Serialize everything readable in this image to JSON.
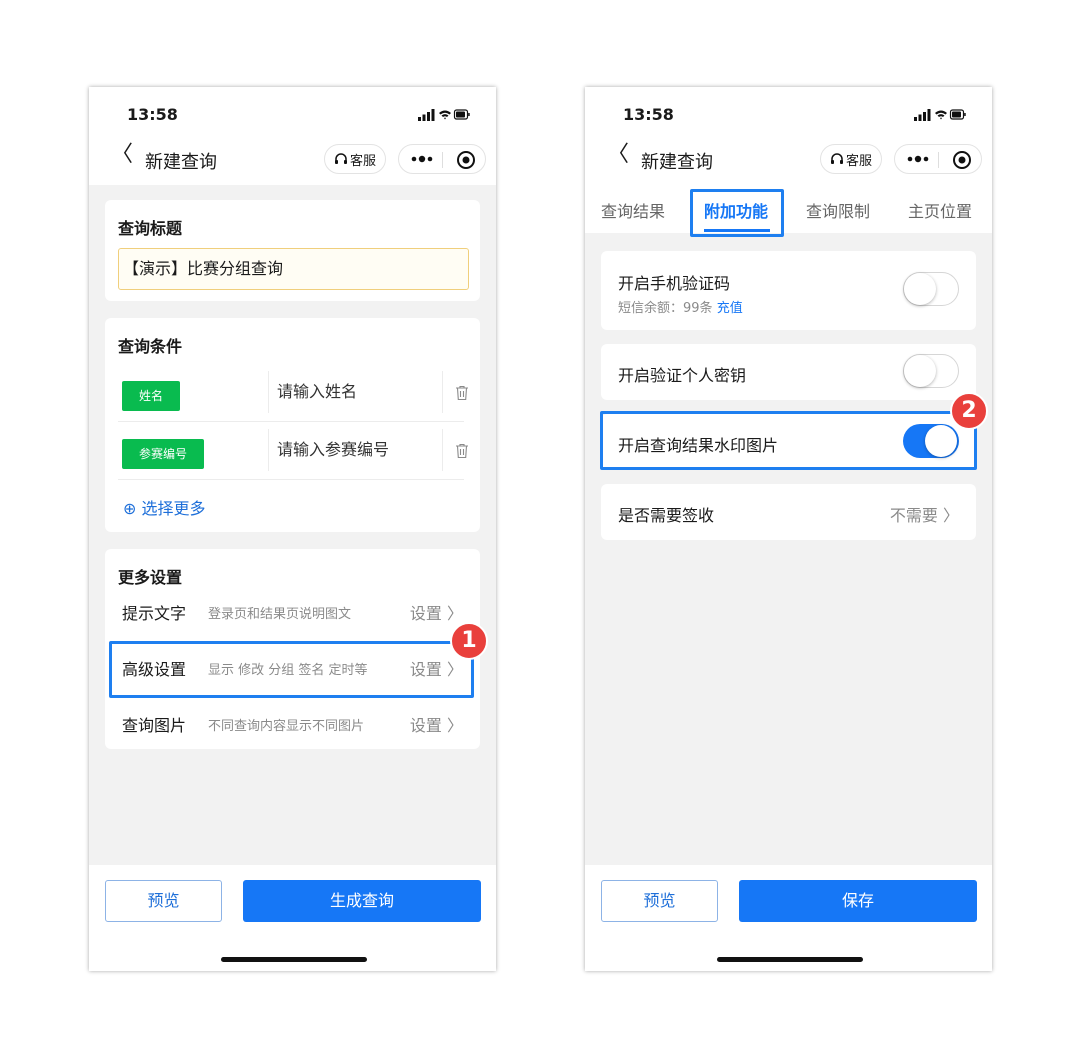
{
  "left_phone": {
    "status": {
      "time": "13:58"
    },
    "nav": {
      "title": "新建查询",
      "service_label": "客服"
    },
    "query_title": {
      "heading": "查询标题",
      "value": "【演示】比赛分组查询"
    },
    "query_conditions": {
      "heading": "查询条件",
      "rows": [
        {
          "tag": "姓名",
          "placeholder": "请输入姓名"
        },
        {
          "tag": "参赛编号",
          "placeholder": "请输入参赛编号"
        }
      ],
      "select_more": "⊕ 选择更多"
    },
    "more_settings": {
      "heading": "更多设置",
      "rows": [
        {
          "label": "提示文字",
          "desc": "登录页和结果页说明图文",
          "action": "设置 〉"
        },
        {
          "label": "高级设置",
          "desc": "显示 修改 分组 签名 定时等",
          "action": "设置 〉"
        },
        {
          "label": "查询图片",
          "desc": "不同查询内容显示不同图片",
          "action": "设置 〉"
        }
      ]
    },
    "bottom": {
      "preview": "预览",
      "primary": "生成查询"
    },
    "badge": "1"
  },
  "right_phone": {
    "status": {
      "time": "13:58"
    },
    "nav": {
      "title": "新建查询",
      "service_label": "客服"
    },
    "tabs": [
      "查询结果",
      "附加功能",
      "查询限制",
      "主页位置"
    ],
    "active_tab": "附加功能",
    "sms": {
      "label": "开启手机验证码",
      "balance": "短信余额：99条",
      "recharge": "充值",
      "enabled": false
    },
    "secret_key": {
      "label": "开启验证个人密钥",
      "enabled": false
    },
    "watermark": {
      "label": "开启查询结果水印图片",
      "enabled": true
    },
    "sign": {
      "label": "是否需要签收",
      "value": "不需要 〉"
    },
    "bottom": {
      "preview": "预览",
      "primary": "保存"
    },
    "badge": "2"
  },
  "colors": {
    "accent_blue": "#1677f6",
    "tag_green": "#09bb4f",
    "badge_red": "#e9403c",
    "highlight_blue": "#1e7ff0"
  }
}
